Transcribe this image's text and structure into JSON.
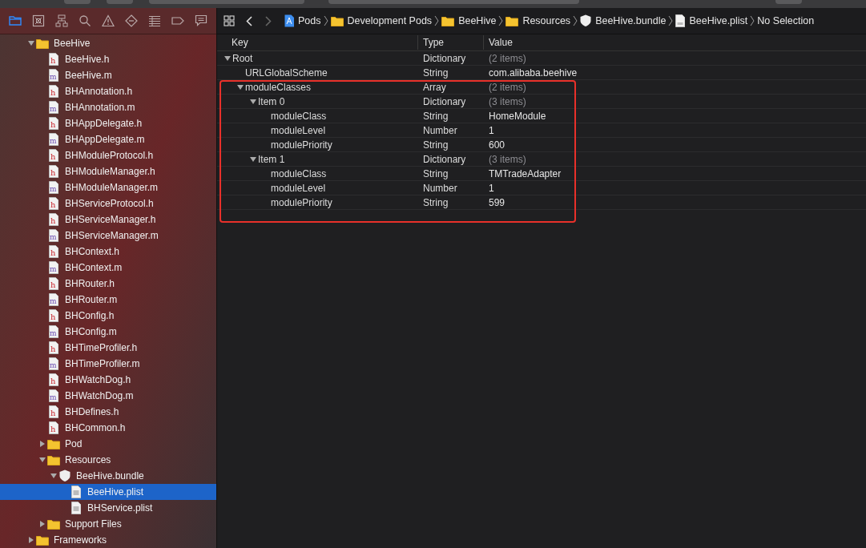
{
  "navigator_tabs": [
    {
      "kind": "folder",
      "selected": true
    },
    {
      "kind": "box-x",
      "selected": false
    },
    {
      "kind": "hierarchy",
      "selected": false
    },
    {
      "kind": "search",
      "selected": false
    },
    {
      "kind": "warning",
      "selected": false
    },
    {
      "kind": "diamond",
      "selected": false
    },
    {
      "kind": "list",
      "selected": false
    },
    {
      "kind": "tag",
      "selected": false
    },
    {
      "kind": "comment",
      "selected": false
    }
  ],
  "breadcrumb": [
    {
      "label": "Pods",
      "kind": "project"
    },
    {
      "label": "Development Pods",
      "kind": "folder"
    },
    {
      "label": "BeeHive",
      "kind": "folder"
    },
    {
      "label": "Resources",
      "kind": "folder"
    },
    {
      "label": "BeeHive.bundle",
      "kind": "bundle"
    },
    {
      "label": "BeeHive.plist",
      "kind": "file"
    },
    {
      "label": "No Selection",
      "kind": "none"
    }
  ],
  "sidebar": {
    "tree": [
      {
        "label": "BeeHive",
        "kind": "folder",
        "expanded": true,
        "selected": false,
        "children": [
          {
            "label": "BeeHive.h",
            "kind": "h",
            "selected": false
          },
          {
            "label": "BeeHive.m",
            "kind": "m",
            "selected": false
          },
          {
            "label": "BHAnnotation.h",
            "kind": "h",
            "selected": false
          },
          {
            "label": "BHAnnotation.m",
            "kind": "m",
            "selected": false
          },
          {
            "label": "BHAppDelegate.h",
            "kind": "h",
            "selected": false
          },
          {
            "label": "BHAppDelegate.m",
            "kind": "m",
            "selected": false
          },
          {
            "label": "BHModuleProtocol.h",
            "kind": "h",
            "selected": false
          },
          {
            "label": "BHModuleManager.h",
            "kind": "h",
            "selected": false
          },
          {
            "label": "BHModuleManager.m",
            "kind": "m",
            "selected": false
          },
          {
            "label": "BHServiceProtocol.h",
            "kind": "h",
            "selected": false
          },
          {
            "label": "BHServiceManager.h",
            "kind": "h",
            "selected": false
          },
          {
            "label": "BHServiceManager.m",
            "kind": "m",
            "selected": false
          },
          {
            "label": "BHContext.h",
            "kind": "h",
            "selected": false
          },
          {
            "label": "BHContext.m",
            "kind": "m",
            "selected": false
          },
          {
            "label": "BHRouter.h",
            "kind": "h",
            "selected": false
          },
          {
            "label": "BHRouter.m",
            "kind": "m",
            "selected": false
          },
          {
            "label": "BHConfig.h",
            "kind": "h",
            "selected": false
          },
          {
            "label": "BHConfig.m",
            "kind": "m",
            "selected": false
          },
          {
            "label": "BHTimeProfiler.h",
            "kind": "h",
            "selected": false
          },
          {
            "label": "BHTimeProfiler.m",
            "kind": "m",
            "selected": false
          },
          {
            "label": "BHWatchDog.h",
            "kind": "h",
            "selected": false
          },
          {
            "label": "BHWatchDog.m",
            "kind": "m",
            "selected": false
          },
          {
            "label": "BHDefines.h",
            "kind": "h",
            "selected": false
          },
          {
            "label": "BHCommon.h",
            "kind": "h",
            "selected": false
          },
          {
            "label": "Pod",
            "kind": "folder",
            "expanded": false,
            "selected": false
          },
          {
            "label": "Resources",
            "kind": "folder",
            "expanded": true,
            "selected": false,
            "children": [
              {
                "label": "BeeHive.bundle",
                "kind": "bundle",
                "expanded": true,
                "selected": false,
                "children": [
                  {
                    "label": "BeeHive.plist",
                    "kind": "plist",
                    "selected": true
                  },
                  {
                    "label": "BHService.plist",
                    "kind": "plist",
                    "selected": false
                  }
                ]
              }
            ]
          },
          {
            "label": "Support Files",
            "kind": "folder",
            "expanded": false,
            "selected": false
          }
        ]
      },
      {
        "label": "Frameworks",
        "kind": "folder",
        "expanded": false,
        "selected": false
      }
    ]
  },
  "plist": {
    "columns": [
      "Key",
      "Type",
      "Value"
    ],
    "rows": [
      {
        "key": "Root",
        "type": "Dictionary",
        "value": "(2 items)",
        "expanded": true,
        "children": [
          {
            "key": "URLGlobalScheme",
            "type": "String",
            "value": "com.alibaba.beehive"
          },
          {
            "key": "moduleClasses",
            "type": "Array",
            "value": "(2 items)",
            "expanded": true,
            "children": [
              {
                "key": "Item 0",
                "type": "Dictionary",
                "value": "(3 items)",
                "expanded": true,
                "children": [
                  {
                    "key": "moduleClass",
                    "type": "String",
                    "value": "HomeModule"
                  },
                  {
                    "key": "moduleLevel",
                    "type": "Number",
                    "value": "1"
                  },
                  {
                    "key": "modulePriority",
                    "type": "String",
                    "value": "600"
                  }
                ]
              },
              {
                "key": "Item 1",
                "type": "Dictionary",
                "value": "(3 items)",
                "expanded": true,
                "children": [
                  {
                    "key": "moduleClass",
                    "type": "String",
                    "value": "TMTradeAdapter"
                  },
                  {
                    "key": "moduleLevel",
                    "type": "Number",
                    "value": "1"
                  },
                  {
                    "key": "modulePriority",
                    "type": "String",
                    "value": "599"
                  }
                ]
              }
            ]
          }
        ]
      }
    ]
  }
}
